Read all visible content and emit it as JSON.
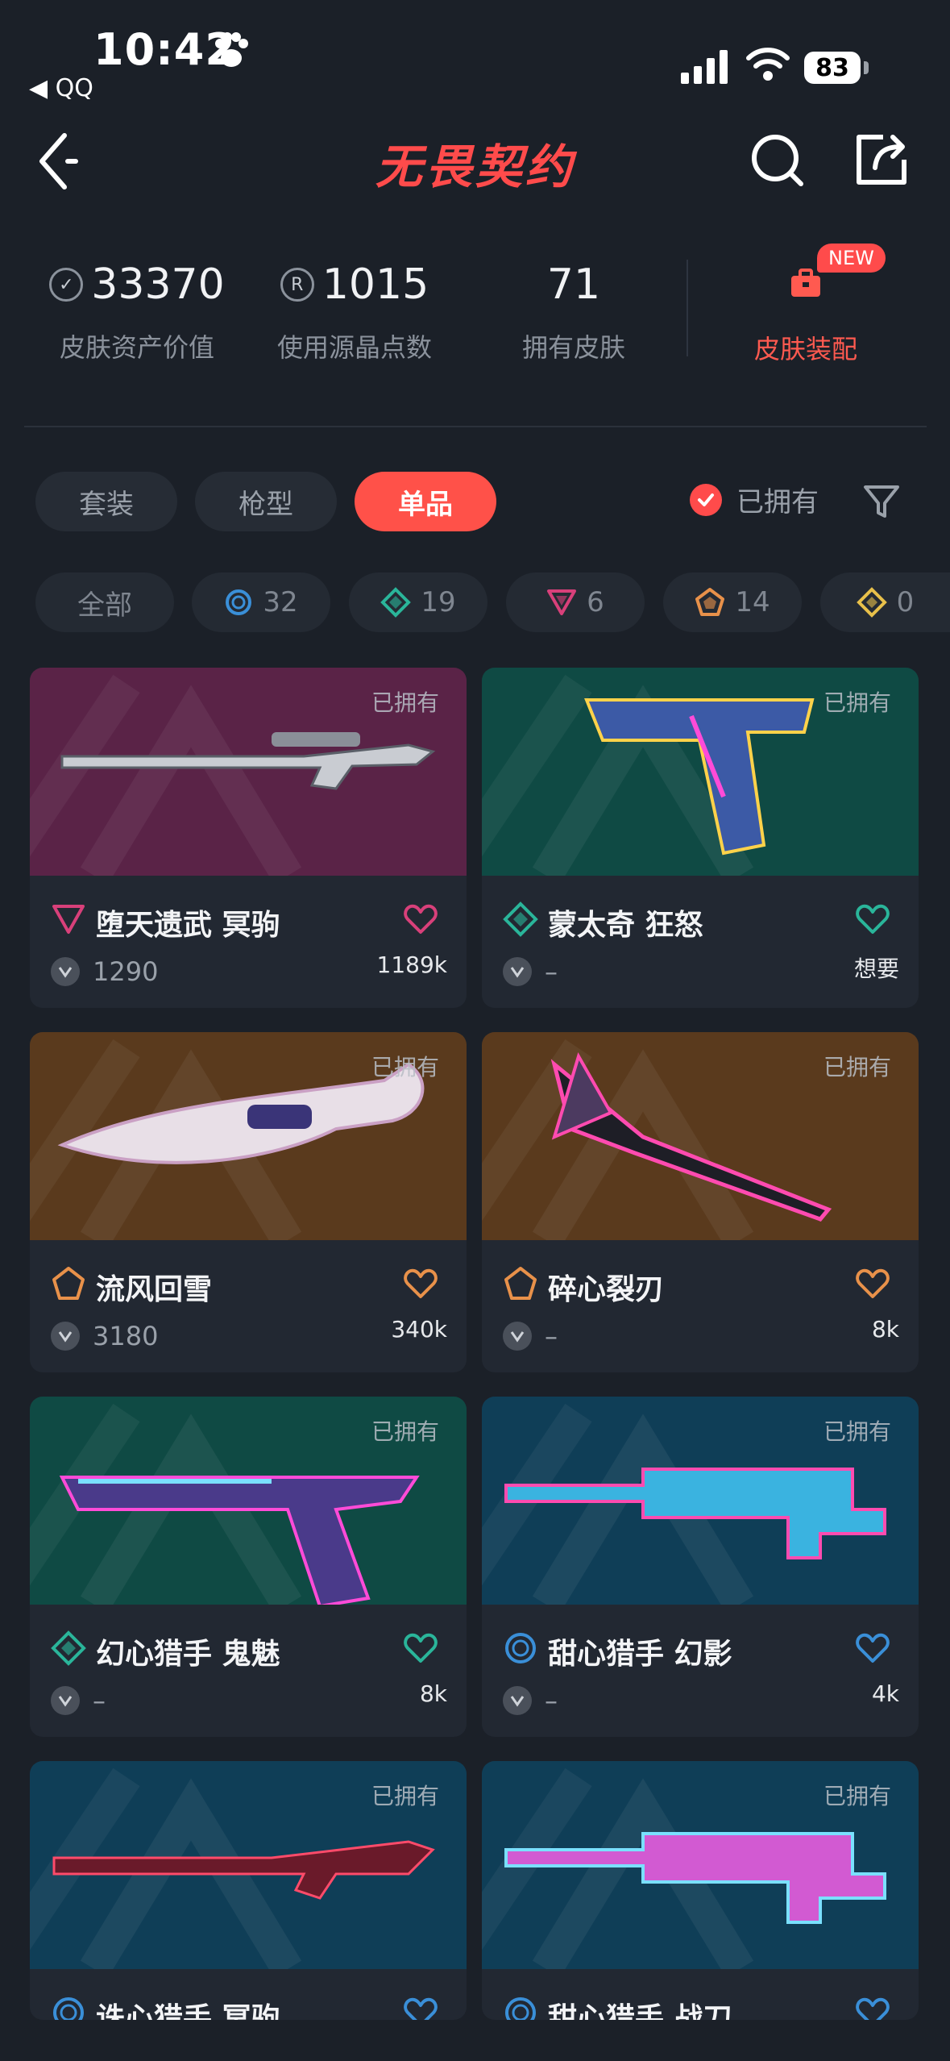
{
  "status_bar": {
    "time": "10:42",
    "back_app": "◀ QQ",
    "battery": "83"
  },
  "header": {
    "title": "无畏契约"
  },
  "stats": [
    {
      "value": "33370",
      "label": "皮肤资产价值",
      "icon": "vp-coin-icon"
    },
    {
      "value": "1015",
      "label": "使用源晶点数",
      "icon": "radianite-icon"
    },
    {
      "value": "71",
      "label": "拥有皮肤",
      "icon": ""
    }
  ],
  "loadout": {
    "label": "皮肤装配",
    "badge": "NEW"
  },
  "tabs": [
    {
      "label": "套装",
      "active": false
    },
    {
      "label": "枪型",
      "active": false
    },
    {
      "label": "单品",
      "active": true
    }
  ],
  "owned_filter": {
    "label": "已拥有",
    "checked": true
  },
  "rarity_chips": [
    {
      "label": "全部"
    },
    {
      "label": "32",
      "tier": "select",
      "color": "#3a8fd8"
    },
    {
      "label": "19",
      "tier": "deluxe",
      "color": "#2ab59a"
    },
    {
      "label": "6",
      "tier": "premium",
      "color": "#d8407a"
    },
    {
      "label": "14",
      "tier": "exclusive",
      "color": "#e8914a"
    },
    {
      "label": "0",
      "tier": "ultra",
      "color": "#e8c04a"
    }
  ],
  "owned_label": "已拥有",
  "cards": [
    {
      "name": "堕天遗武 冥驹",
      "price": "1290",
      "count": "1189k",
      "tier_color": "#d8407a",
      "bg": "#5a2347"
    },
    {
      "name": "蒙太奇 狂怒",
      "price": "–",
      "count": "想要",
      "tier_color": "#2ab59a",
      "bg": "#0f4a44"
    },
    {
      "name": "流风回雪",
      "price": "3180",
      "count": "340k",
      "tier_color": "#e8914a",
      "bg": "#5a3a1d"
    },
    {
      "name": "碎心裂刃",
      "price": "–",
      "count": "8k",
      "tier_color": "#e8914a",
      "bg": "#5a3a1d"
    },
    {
      "name": "幻心猎手 鬼魅",
      "price": "–",
      "count": "8k",
      "tier_color": "#2ab59a",
      "bg": "#0f4a44"
    },
    {
      "name": "甜心猎手 幻影",
      "price": "–",
      "count": "4k",
      "tier_color": "#3a8fd8",
      "bg": "#0f3e57"
    },
    {
      "name": "诛心猎手 冥驹",
      "price": "",
      "count": "",
      "tier_color": "#3a8fd8",
      "bg": "#0f3e57"
    },
    {
      "name": "甜心猎手 战刀",
      "price": "",
      "count": "",
      "tier_color": "#3a8fd8",
      "bg": "#0f3e57"
    }
  ]
}
